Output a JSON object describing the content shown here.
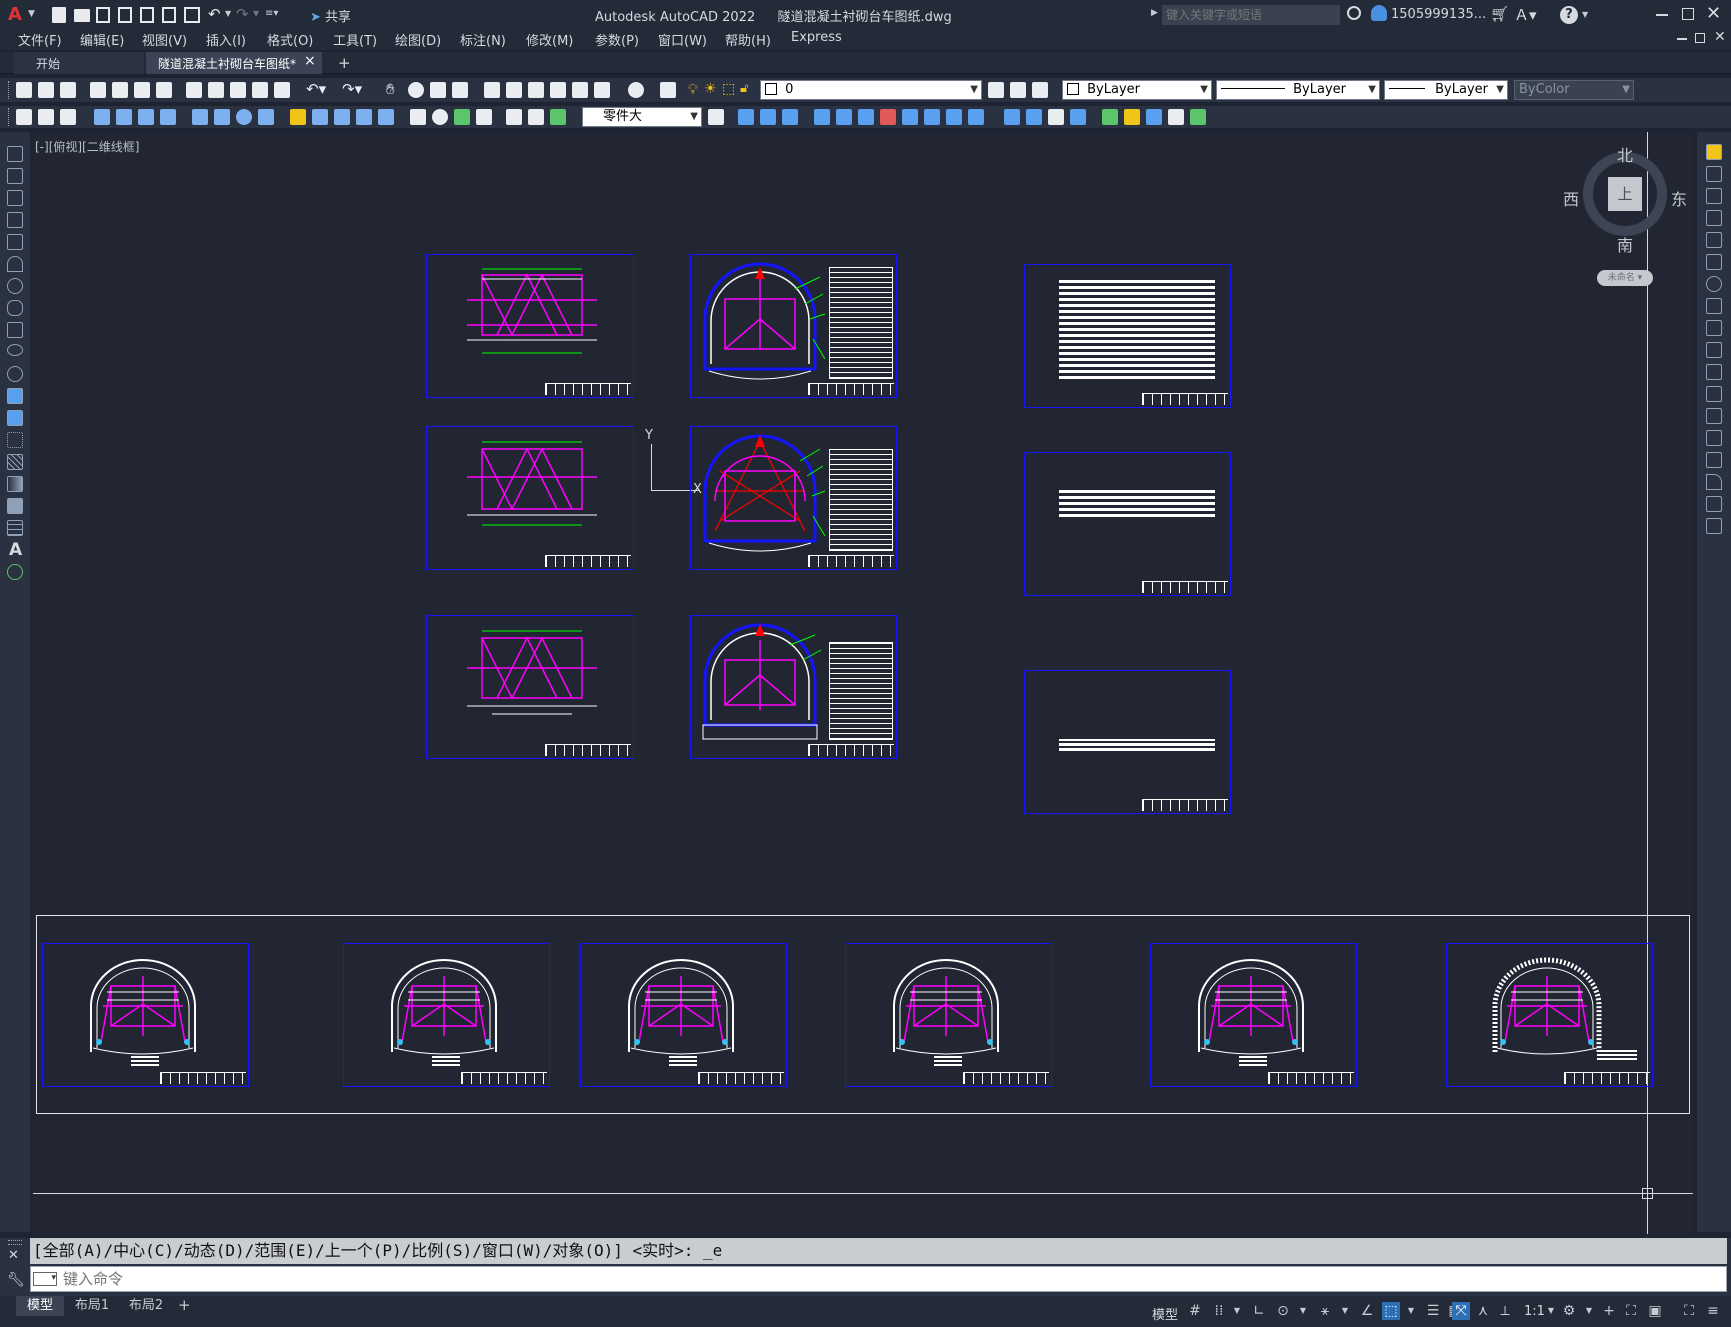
{
  "app": {
    "title": "Autodesk AutoCAD 2022",
    "document": "隧道混凝土衬砌台车图纸.dwg",
    "share_label": "共享",
    "search_placeholder": "键入关键字或短语",
    "user": "1505999135...",
    "help": "?"
  },
  "menu": [
    "文件(F)",
    "编辑(E)",
    "视图(V)",
    "插入(I)",
    "格式(O)",
    "工具(T)",
    "绘图(D)",
    "标注(N)",
    "修改(M)",
    "参数(P)",
    "窗口(W)",
    "帮助(H)",
    "Express"
  ],
  "tabs": {
    "start": "开始",
    "active": "隧道混凝土衬砌台车图纸*",
    "close": "×",
    "add": "+"
  },
  "toolbar": {
    "layer_value": "0",
    "color": "ByLayer",
    "linetype": "ByLayer",
    "lineweight": "ByLayer",
    "plotstyle": "ByColor",
    "textstyle": "零件大"
  },
  "viewport": {
    "label": "[-][俯视][二维线框]",
    "ucs_y": "Y",
    "ucs_x": "X"
  },
  "viewcube": {
    "north": "北",
    "south": "南",
    "east": "东",
    "west": "西",
    "face": "上",
    "wcs": "未命名 ▾"
  },
  "command": {
    "history": "[全部(A)/中心(C)/动态(D)/范围(E)/上一个(P)/比例(S)/窗口(W)/对象(O)] <实时>: _e",
    "placeholder": "键入命令"
  },
  "layout_tabs": [
    "模型",
    "布局1",
    "布局2"
  ],
  "status": {
    "model": "模型",
    "scale": "1:1"
  },
  "colors": {
    "frame_blue": "#1414ff",
    "magenta": "#ff00ff",
    "green": "#00ff00",
    "red": "#ff0000",
    "white": "#ffffff",
    "canvas_bg": "#212632"
  }
}
